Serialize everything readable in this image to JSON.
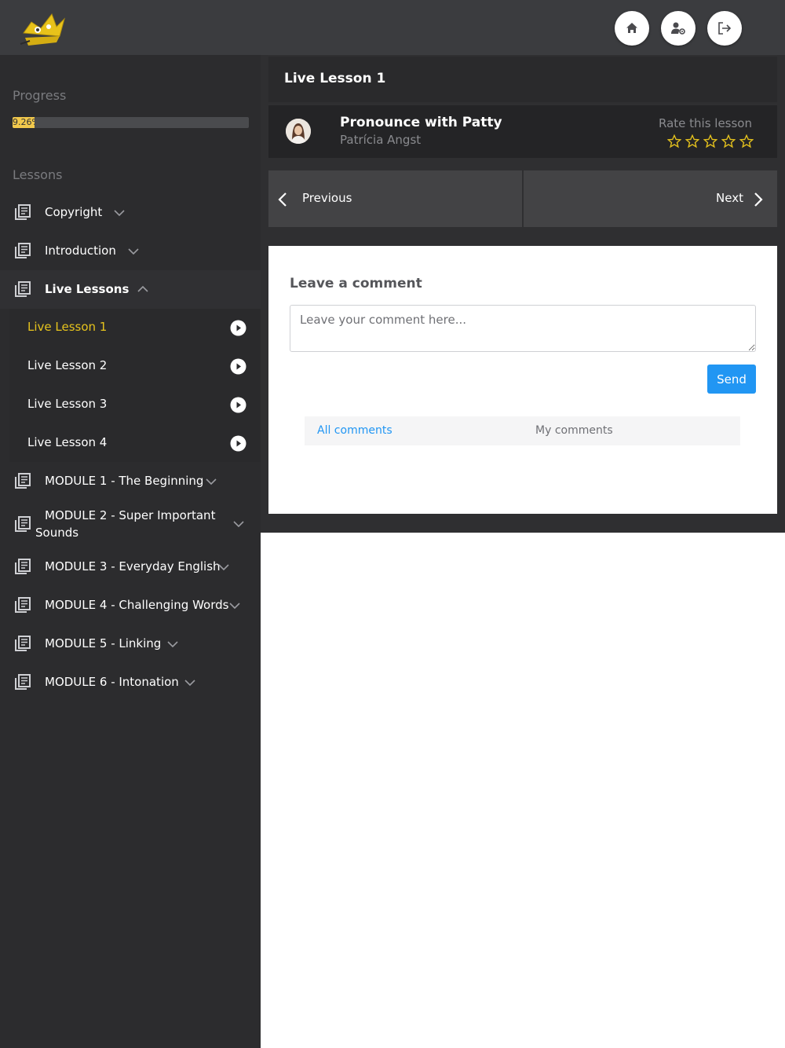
{
  "topbar": {
    "logo": "crown-logo",
    "buttons": [
      {
        "icon": "home-icon"
      },
      {
        "icon": "user-settings-icon"
      },
      {
        "icon": "logout-icon"
      }
    ]
  },
  "sidebar": {
    "progress_label": "Progress",
    "progress_value": "9.26%",
    "progress_fraction": 0.0926,
    "lessons_label": "Lessons",
    "modules_top": [
      {
        "label": "Copyright"
      },
      {
        "label": "Introduction"
      }
    ],
    "expanded_module": {
      "label": "Live Lessons"
    },
    "lessons": [
      {
        "label": "Live Lesson 1",
        "active": true
      },
      {
        "label": "Live Lesson 2",
        "active": false
      },
      {
        "label": "Live Lesson 3",
        "active": false
      },
      {
        "label": "Live Lesson 4",
        "active": false
      }
    ],
    "modules_bottom": [
      {
        "label": "MODULE 1 - The Beginning"
      },
      {
        "label_line1": "MODULE 2 - Super Important",
        "label_line2": "Sounds"
      },
      {
        "label": "MODULE 3 - Everyday English"
      },
      {
        "label": "MODULE 4 - Challenging Words"
      },
      {
        "label": "MODULE 5 - Linking"
      },
      {
        "label": "MODULE 6 - Intonation"
      }
    ]
  },
  "main": {
    "lesson_title": "Live Lesson 1",
    "course_name": "Pronounce with Patty",
    "teacher_name": "Patrícia Angst",
    "rate_label": "Rate this lesson",
    "star_count": 5,
    "rating": 0,
    "prev_label": "Previous",
    "next_label": "Next",
    "comments": {
      "title": "Leave a comment",
      "placeholder": "Leave your comment here...",
      "send_label": "Send",
      "tabs": [
        {
          "label": "All comments",
          "active": true
        },
        {
          "label": "My comments",
          "active": false
        }
      ]
    }
  },
  "colors": {
    "accent": "#2196f3",
    "active_lesson": "#e6c31d",
    "progress_fill": "#f2c94c",
    "sidebar_bg": "#2c2c2e",
    "topbar_bg": "#3b3c3f"
  }
}
